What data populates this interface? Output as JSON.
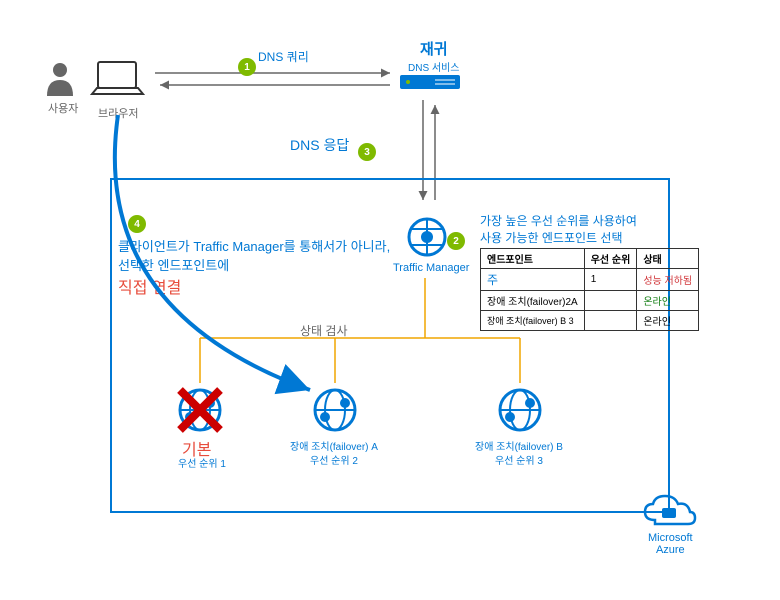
{
  "user": {
    "label": "사용자"
  },
  "browser": {
    "label": "브라우저"
  },
  "recursive_dns": {
    "title": "재귀",
    "subtitle": "DNS 서비스"
  },
  "annotations": {
    "dns_query": "DNS 쿼리",
    "dns_response": "DNS 응답",
    "client_text_line1": "클라이언트가 Traffic Manager를 통해서가 아니라,",
    "client_text_line2": "선택한 엔드포인트에",
    "client_text_line3": "직접 연결",
    "health_check": "상태 검사",
    "priority_select_line1": "가장 높은 우선 순위를 사용하여",
    "priority_select_line2": "사용 가능한 엔드포인트 선택"
  },
  "traffic_manager": {
    "label": "Traffic Manager"
  },
  "endpoints": {
    "primary": {
      "label": "기본",
      "priority": "우선 순위 1"
    },
    "failover_a": {
      "label": "장애 조치(failover) A",
      "priority": "우선 순위 2"
    },
    "failover_b": {
      "label": "장애 조치(failover) B",
      "priority": "우선 순위 3"
    }
  },
  "table": {
    "headers": {
      "endpoint": "엔드포인트",
      "priority": "우선 순위",
      "status": "상태"
    },
    "rows": [
      {
        "endpoint": "주",
        "priority": "1",
        "status": "성능 저하됨",
        "status_class": "status-red"
      },
      {
        "endpoint": "장애 조치(failover)2A",
        "priority": "",
        "status": "온라인",
        "status_class": "status-green"
      },
      {
        "endpoint": "장애 조치(failover) B 3",
        "priority": "",
        "status": "온라인",
        "status_class": ""
      }
    ]
  },
  "azure": {
    "label1": "Microsoft",
    "label2": "Azure"
  },
  "steps": {
    "s1": "1",
    "s2": "2",
    "s3": "3",
    "s4": "4"
  }
}
